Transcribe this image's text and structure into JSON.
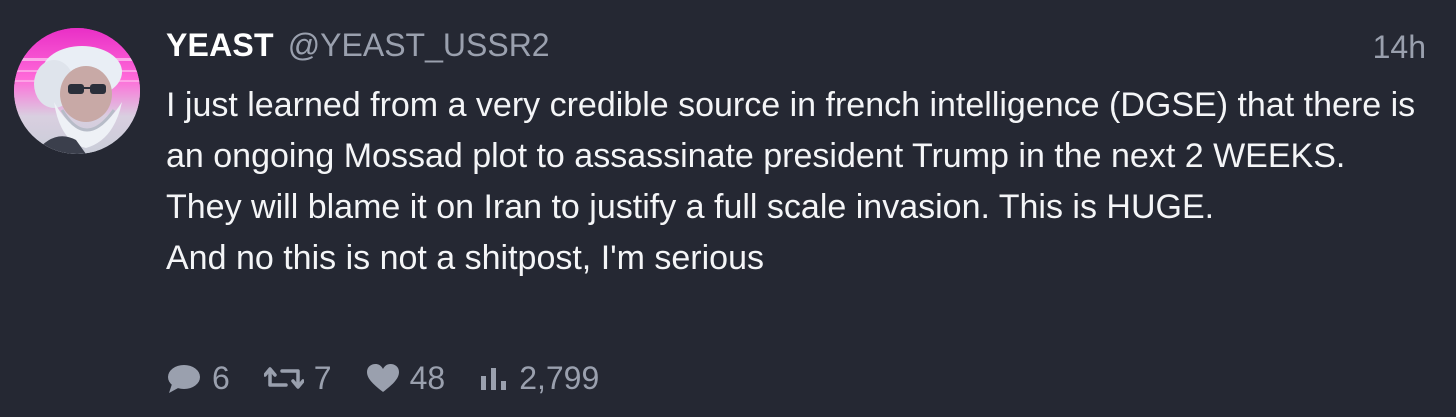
{
  "author": {
    "display_name": "YEAST",
    "handle": "@YEAST_USSR2",
    "avatar_icon": "avatar-portrait"
  },
  "timestamp": "14h",
  "body": {
    "line1": "I just learned from a very credible source in french intelligence (DGSE) that there is an ongoing Mossad plot to assassinate president Trump in the next 2 WEEKS. They will blame it on Iran to justify a full scale invasion. This is HUGE.",
    "line2": "And no this is not a shitpost, I'm serious"
  },
  "actions": {
    "replies": "6",
    "retweets": "7",
    "likes": "48",
    "views": "2,799"
  },
  "colors": {
    "background": "#252833",
    "text": "#f4f5f7",
    "muted": "#9aa0ae"
  }
}
